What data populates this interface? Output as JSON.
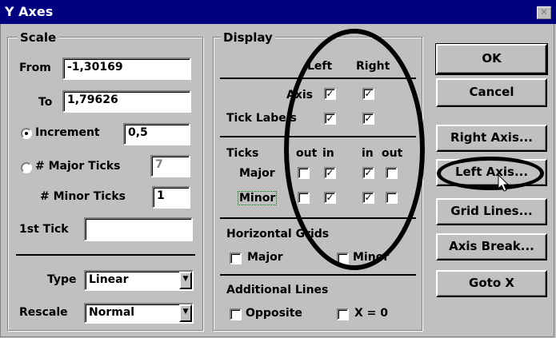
{
  "window": {
    "title": "Y Axes",
    "close_glyph": "✕"
  },
  "scale": {
    "legend": "Scale",
    "from_label": "From",
    "from_value": "-1,30169",
    "to_label": "To",
    "to_value": "1,79626",
    "increment_label": "Increment",
    "increment_value": "0,5",
    "major_ticks_label": "# Major Ticks",
    "major_ticks_value": "7",
    "minor_ticks_label": "# Minor Ticks",
    "minor_ticks_value": "1",
    "first_tick_label": "1st Tick",
    "first_tick_value": "",
    "type_label": "Type",
    "type_value": "Linear",
    "rescale_label": "Rescale",
    "rescale_value": "Normal"
  },
  "display": {
    "legend": "Display",
    "left_header": "Left",
    "right_header": "Right",
    "axis_label": "Axis",
    "tick_labels_label": "Tick Labels",
    "ticks_label": "Ticks",
    "out_label": "out",
    "in_label": "in",
    "major_label": "Major",
    "minor_label": "Minor",
    "horizontal_grids_label": "Horizontal Grids",
    "hg_major_label": "Major",
    "hg_minor_label": "Minor",
    "additional_lines_label": "Additional Lines",
    "opposite_label": "Opposite",
    "x0_label": "X = 0",
    "check_glyph": "✓"
  },
  "buttons": {
    "ok": "OK",
    "cancel": "Cancel",
    "right_axis": "Right Axis...",
    "left_axis": "Left Axis...",
    "grid_lines": "Grid Lines...",
    "axis_break": "Axis Break...",
    "goto_x": "Goto X"
  }
}
